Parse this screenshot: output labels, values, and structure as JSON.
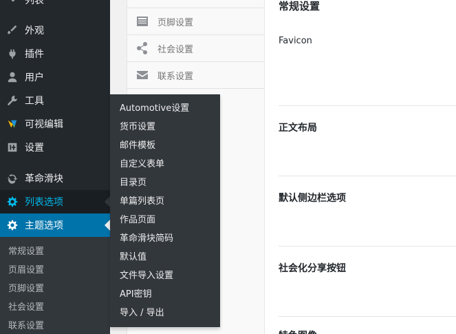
{
  "menu": {
    "top_partial": "列表",
    "items": [
      {
        "label": "外观",
        "icon": "brush-icon"
      },
      {
        "label": "插件",
        "icon": "plugin-icon"
      },
      {
        "label": "用户",
        "icon": "user-icon"
      },
      {
        "label": "工具",
        "icon": "wrench-icon"
      },
      {
        "label": "可视编辑",
        "icon": "visual-composer-icon"
      },
      {
        "label": "设置",
        "icon": "settings-sliders-icon"
      },
      {
        "label": "革命滑块",
        "icon": "refresh-icon"
      },
      {
        "label": "列表选项",
        "icon": "gear-icon"
      },
      {
        "label": "主题选项",
        "icon": "gear-icon"
      }
    ],
    "submenu": [
      "常规设置",
      "页眉设置",
      "页脚设置",
      "社会设置",
      "联系设置"
    ]
  },
  "flyout": [
    "Automotive设置",
    "货币设置",
    "邮件模板",
    "自定义表单",
    "目录页",
    "单篇列表页",
    "作品页面",
    "革命滑块简码",
    "默认值",
    "文件导入设置",
    "API密钥",
    "导入 / 导出"
  ],
  "tabs": [
    {
      "label": "页脚设置",
      "icon": "footer-icon"
    },
    {
      "label": "社会设置",
      "icon": "share-icon"
    },
    {
      "label": "联系设置",
      "icon": "envelope-icon"
    }
  ],
  "panel": {
    "heading": "常规设置",
    "favicon_label": "Favicon",
    "sections": [
      "正文布局",
      "默认侧边栏选项",
      "社会化分享按钮",
      "特色图像"
    ]
  },
  "colors": {
    "sidebar_bg": "#23282d",
    "current_bg": "#0073aa",
    "flyout_bg": "#32373c",
    "hover_text": "#00b9eb"
  }
}
